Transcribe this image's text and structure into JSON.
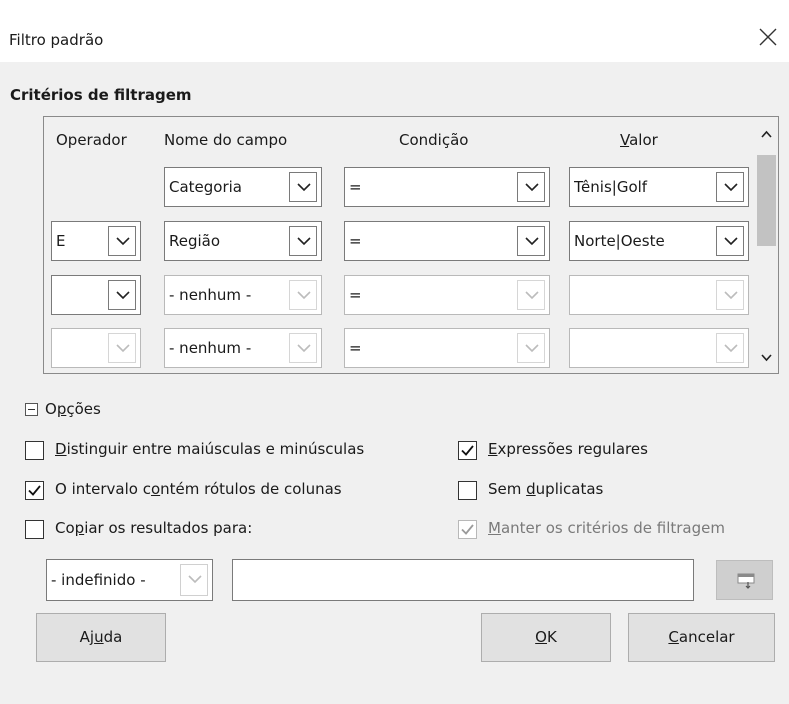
{
  "window": {
    "title": "Filtro padrão"
  },
  "criteria": {
    "heading": "Critérios de filtragem",
    "headers": {
      "operator": "Operador",
      "field": "Nome do campo",
      "condition": "Condição",
      "value_pre": "",
      "value_ul": "V",
      "value_post": "alor"
    },
    "rows": [
      {
        "operator": "",
        "field": "Categoria",
        "condition": "=",
        "value": "Tênis|Golf"
      },
      {
        "operator": "E",
        "field": "Região",
        "condition": "=",
        "value": "Norte|Oeste"
      },
      {
        "operator": "",
        "field": "- nenhum -",
        "condition": "=",
        "value": ""
      },
      {
        "operator": "",
        "field": "- nenhum -",
        "condition": "=",
        "value": ""
      }
    ]
  },
  "options": {
    "heading_pre": "O",
    "heading_ul": "p",
    "heading_post": "ções",
    "case_sensitive": {
      "pre": "",
      "ul": "D",
      "post": "istinguir entre maiúsculas e minúsculas",
      "checked": false
    },
    "regex": {
      "pre": "",
      "ul": "E",
      "post": "xpressões regulares",
      "checked": true
    },
    "range_has_labels": {
      "pre": "O intervalo c",
      "ul": "o",
      "post": "ntém rótulos de colunas",
      "checked": true
    },
    "no_duplicates": {
      "pre": "Sem ",
      "ul": "d",
      "post": "uplicatas",
      "checked": false
    },
    "copy_results": {
      "pre": "Co",
      "ul": "p",
      "post": "iar os resultados para:",
      "checked": false
    },
    "keep_criteria": {
      "pre": "",
      "ul": "M",
      "post": "anter os critérios de filtragem",
      "checked": true,
      "disabled": true
    },
    "target_select": "- indefinido -",
    "target_input": ""
  },
  "buttons": {
    "help_pre": "Aj",
    "help_ul": "u",
    "help_post": "da",
    "ok_pre": "",
    "ok_ul": "O",
    "ok_post": "K",
    "cancel_pre": "",
    "cancel_ul": "C",
    "cancel_post": "ancelar"
  }
}
